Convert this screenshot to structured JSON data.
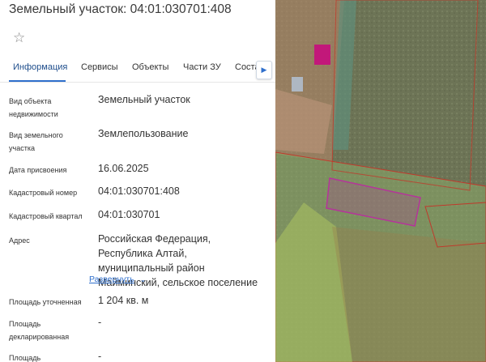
{
  "header": {
    "title": "Земельный участок: 04:01:030701:408"
  },
  "tabs": [
    {
      "label": "Информация"
    },
    {
      "label": "Сервисы"
    },
    {
      "label": "Объекты"
    },
    {
      "label": "Части ЗУ"
    },
    {
      "label": "Соста"
    }
  ],
  "fields": {
    "object_type": {
      "label": "Вид объекта недвижимости",
      "value": "Земельный участок"
    },
    "land_use": {
      "label": "Вид земельного участка",
      "value": "Землепользование"
    },
    "assign_date": {
      "label": "Дата присвоения",
      "value": "16.06.2025"
    },
    "cad_number": {
      "label": "Кадастровый номер",
      "value": "04:01:030701:408"
    },
    "cad_quarter": {
      "label": "Кадастровый квартал",
      "value": "04:01:030701"
    },
    "address": {
      "label": "Адрес",
      "value": "Российская Федерация, Республика Алтай, муниципальный район Майминский, сельское поселение",
      "expand": "Развернуть"
    },
    "area_specified": {
      "label": "Площадь уточненная",
      "value": "1 204 кв. м"
    },
    "area_declared": {
      "label": "Площадь декларированная",
      "value": "-"
    },
    "area_last": {
      "label": "Площадь",
      "value": "-"
    }
  },
  "icons": {
    "favorite": "star-outline-icon",
    "tab_scroll": "chevron-right-icon",
    "expand": "chevron-down-icon"
  },
  "colors": {
    "accent": "#2f6fcc",
    "parcel_outline": "#b5349a",
    "zone_green": "#8fbf5a",
    "zone_red": "#c0392b"
  }
}
